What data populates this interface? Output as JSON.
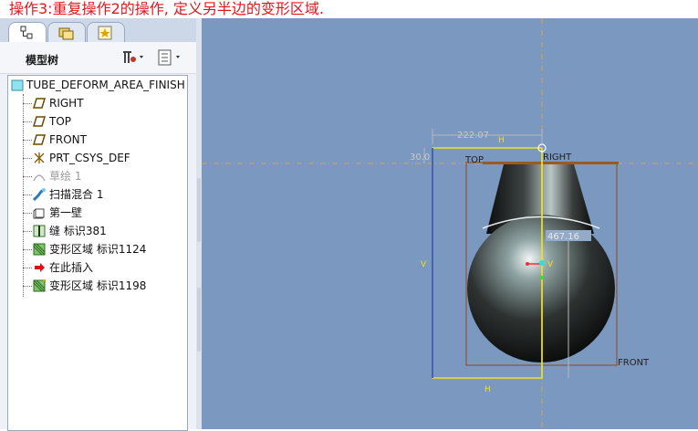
{
  "caption": "操作3:重复操作2的操作, 定义另半边的变形区域.",
  "model_tree": {
    "title": "模型树",
    "root_label": "TUBE_DEFORM_AREA_FINISH",
    "items": [
      {
        "label": "RIGHT",
        "icon": "datum-plane-icon"
      },
      {
        "label": "TOP",
        "icon": "datum-plane-icon"
      },
      {
        "label": "FRONT",
        "icon": "datum-plane-icon"
      },
      {
        "label": "PRT_CSYS_DEF",
        "icon": "coordinate-system-icon"
      },
      {
        "label": "草绘 1",
        "icon": "sketch-icon"
      },
      {
        "label": "扫描混合 1",
        "icon": "swept-blend-icon"
      },
      {
        "label": "第一壁",
        "icon": "first-wall-icon"
      },
      {
        "label": "缝 标识381",
        "icon": "seam-icon"
      },
      {
        "label": "变形区域 标识1124",
        "icon": "deform-area-icon"
      },
      {
        "label": "在此插入",
        "icon": "insert-here-arrow-icon"
      },
      {
        "label": "变形区域 标识1198",
        "icon": "deform-area-new-icon"
      }
    ]
  },
  "viewport": {
    "background": "#7a98c0",
    "labels": {
      "top": "TOP",
      "right": "RIGHT",
      "front": "FRONT",
      "dim_width": "222.07",
      "dim_offset": "30.0",
      "dim_depth": "467.16",
      "h_top": "H",
      "h_bottom": "H",
      "v_left": "V",
      "v_center": "V"
    }
  }
}
